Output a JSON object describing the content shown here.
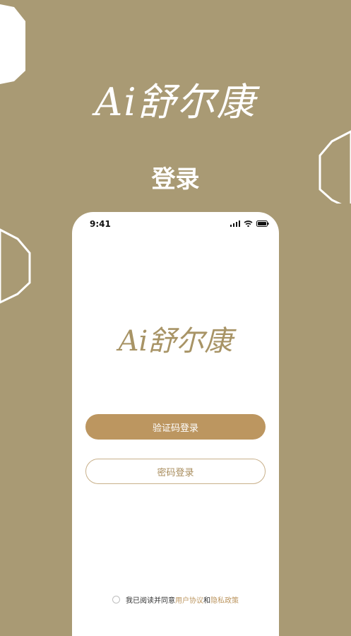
{
  "brand": {
    "logo_text": "Ai舒尔康"
  },
  "page": {
    "headline": "登录"
  },
  "status_bar": {
    "time": "9:41"
  },
  "login": {
    "sms_login_label": "验证码登录",
    "password_login_label": "密码登录"
  },
  "agreement": {
    "prefix": "我已阅读并同意",
    "user_agreement": "用户协议",
    "conjunction": "和",
    "privacy_policy": "隐私政策"
  },
  "colors": {
    "background": "#a99a74",
    "accent": "#bc9660",
    "brand_gold": "#a89466"
  }
}
